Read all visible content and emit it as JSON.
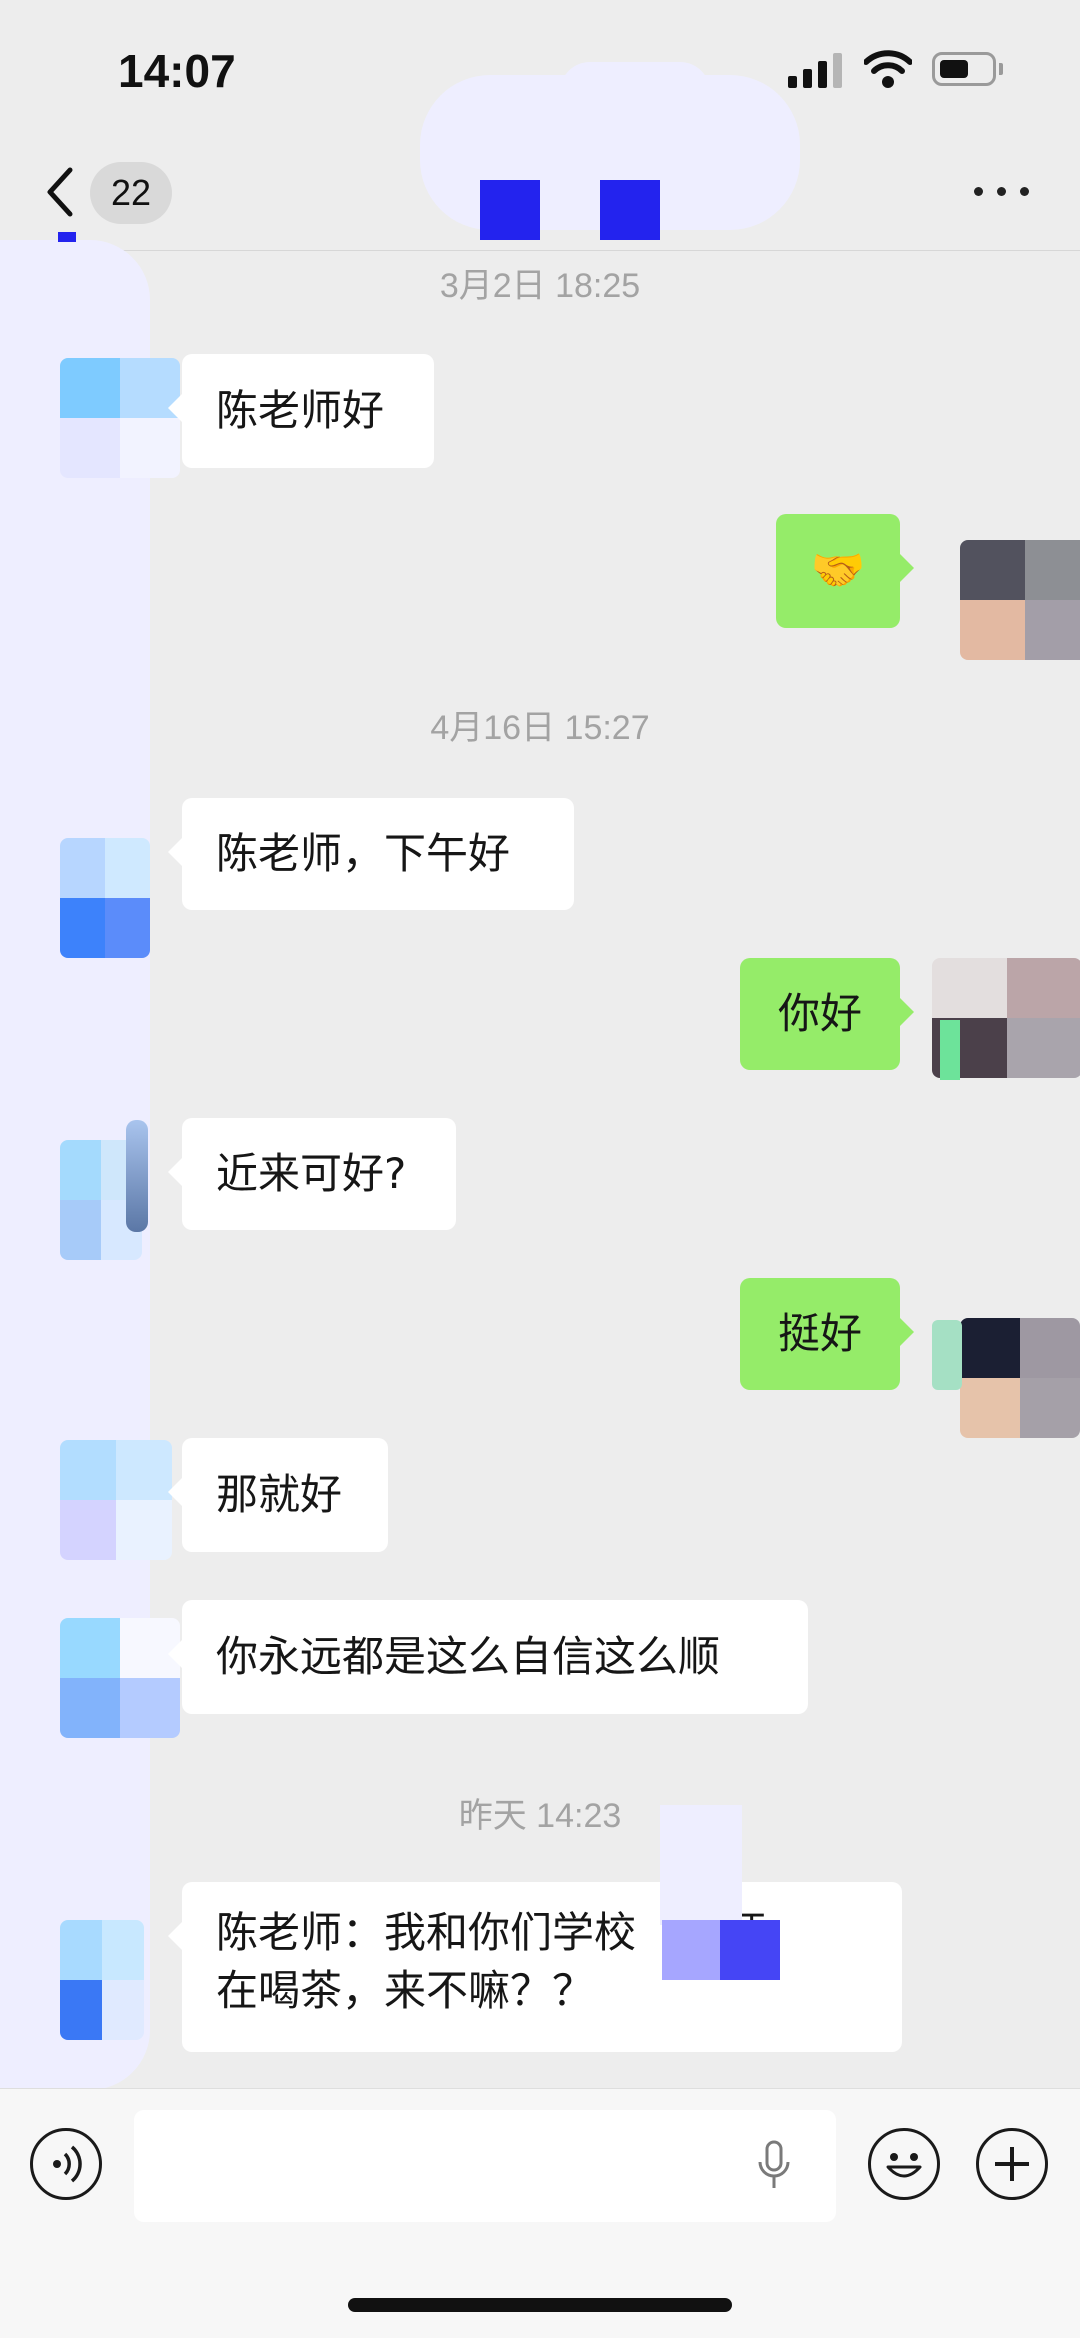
{
  "status": {
    "time": "14:07"
  },
  "nav": {
    "unread": "22"
  },
  "chat": {
    "stamps": [
      "3月2日 18:25",
      "4月16日 15:27",
      "昨天 14:23"
    ],
    "messages": [
      {
        "side": "in",
        "text": "陈老师好"
      },
      {
        "side": "out",
        "text": "🤝"
      },
      {
        "side": "in",
        "text": "陈老师，下午好"
      },
      {
        "side": "out",
        "text": "你好"
      },
      {
        "side": "in",
        "text": "近来可好?"
      },
      {
        "side": "out",
        "text": "挺好"
      },
      {
        "side": "in",
        "text": "那就好"
      },
      {
        "side": "in",
        "text": "你永远都是这么自信这么顺"
      },
      {
        "side": "in",
        "line1": "陈老师：我和你们学校",
        "line1_tail": "老师",
        "line2": "在喝茶，来不嘛？？"
      }
    ]
  },
  "colors": {
    "bubble_out": "#95ec69",
    "bubble_in": "#ffffff",
    "background": "#ededed"
  },
  "icons": [
    "back-chevron-icon",
    "more-dots-icon",
    "voice-icon",
    "microphone-icon",
    "emoji-icon",
    "plus-icon",
    "cellular-signal-icon",
    "wifi-icon",
    "battery-icon"
  ]
}
